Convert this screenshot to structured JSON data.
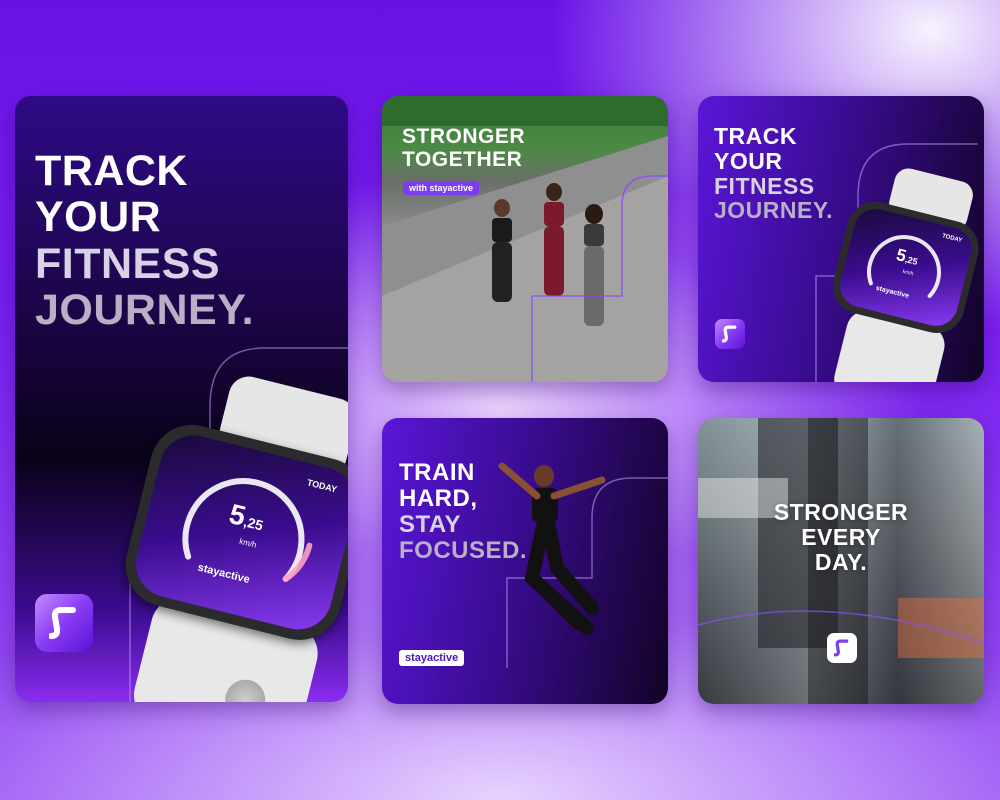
{
  "cards": {
    "tall": {
      "headline": [
        "TRACK",
        "YOUR",
        "FITNESS",
        "JOURNEY."
      ],
      "watch": {
        "label_today": "TODAY",
        "speed_int": "5",
        "speed_dec": ",25",
        "unit": "km/h",
        "brand": "stayactive"
      }
    },
    "runners": {
      "headline": [
        "STRONGER",
        "TOGETHER"
      ],
      "badge": "with stayactive"
    },
    "watch_small": {
      "headline": [
        "TRACK",
        "YOUR",
        "FITNESS",
        "JOURNEY."
      ],
      "watch": {
        "label_today": "TODAY",
        "speed_int": "5",
        "speed_dec": ",25",
        "unit": "km/h",
        "brand": "stayactive"
      }
    },
    "train": {
      "headline": [
        "TRAIN",
        "HARD,",
        "STAY",
        "FOCUSED."
      ],
      "brand_pill": "stayactive"
    },
    "blur": {
      "headline": [
        "STRONGER",
        "EVERY",
        "DAY."
      ]
    }
  },
  "colors": {
    "accent": "#7c3cf0",
    "dark": "#120326"
  }
}
